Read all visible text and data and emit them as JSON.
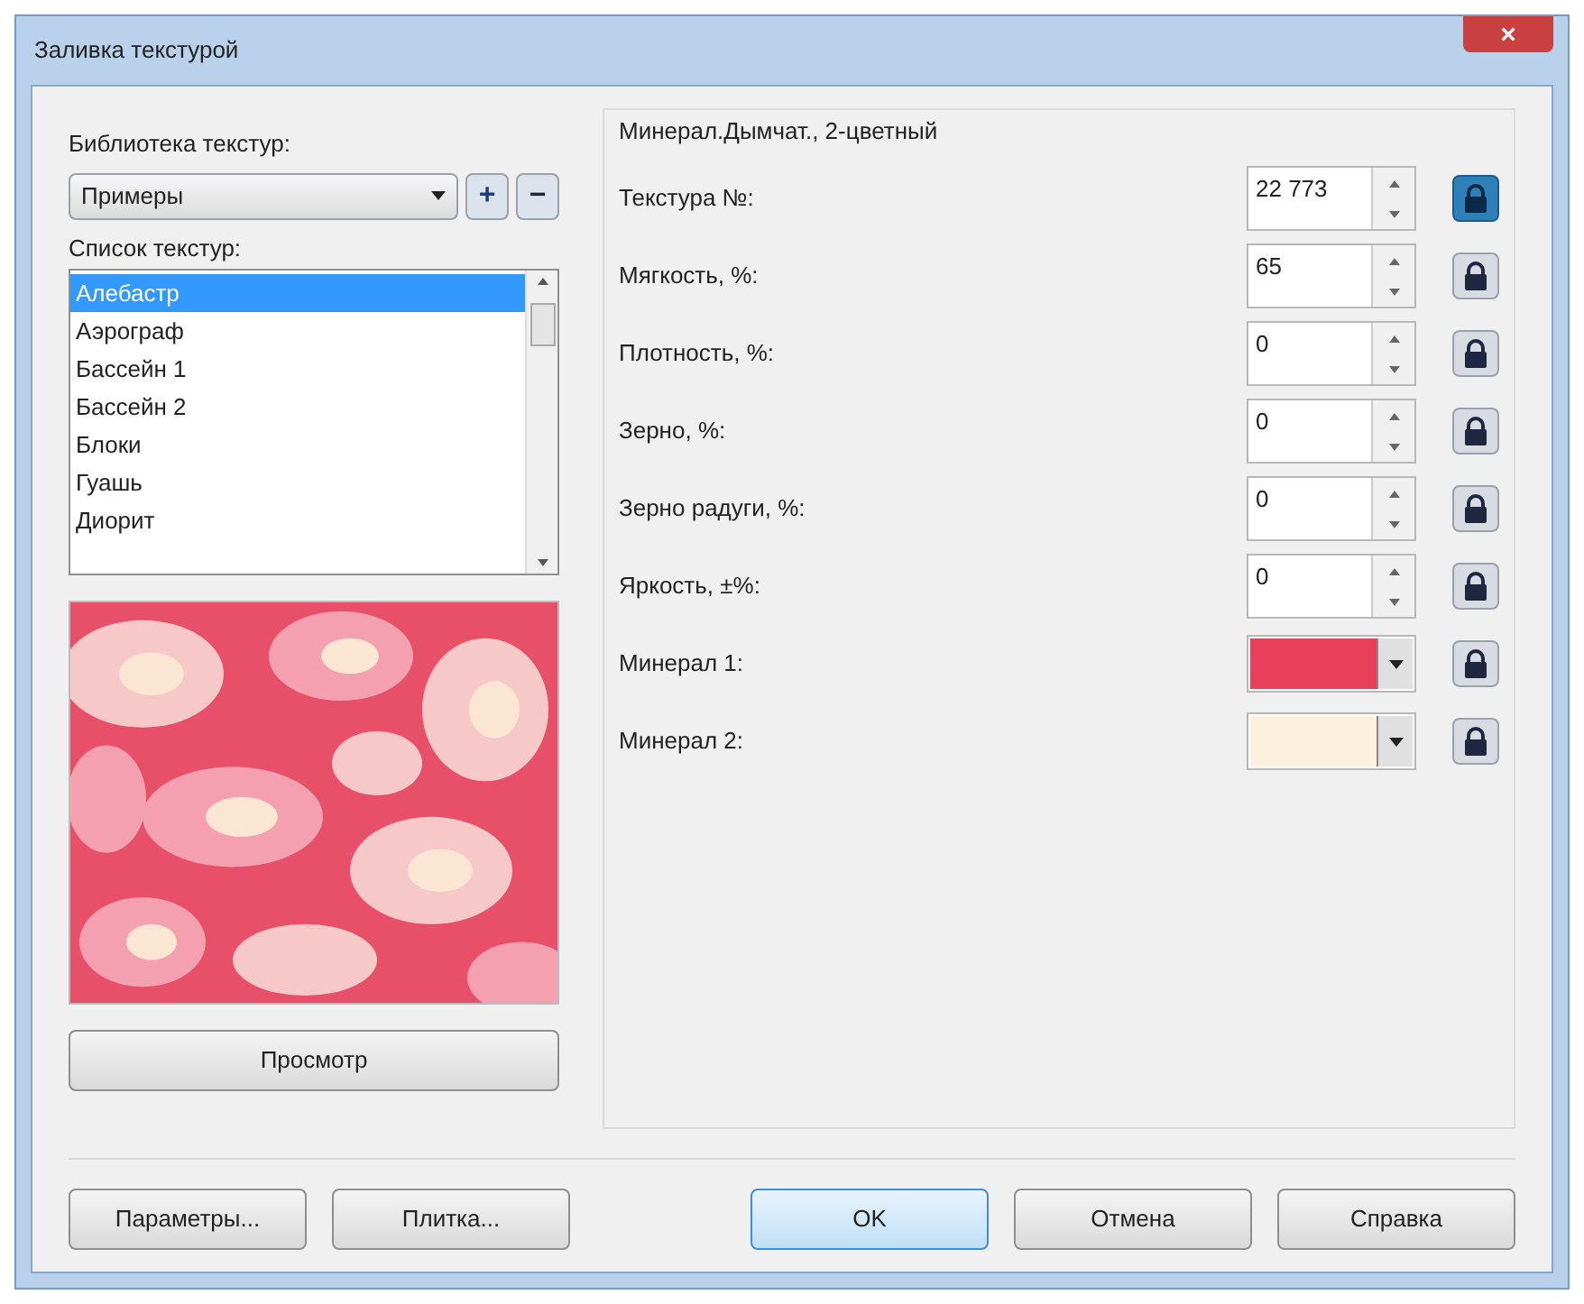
{
  "window": {
    "title": "Заливка текстурой",
    "close": "×"
  },
  "library": {
    "label": "Библиотека текстур:",
    "value": "Примеры",
    "add": "+",
    "remove": "−"
  },
  "texture_list": {
    "label": "Список текстур:",
    "items": [
      {
        "name": "Алебастр",
        "selected": true
      },
      {
        "name": "Аэрограф",
        "selected": false
      },
      {
        "name": "Бассейн 1",
        "selected": false
      },
      {
        "name": "Бассейн 2",
        "selected": false
      },
      {
        "name": "Блоки",
        "selected": false
      },
      {
        "name": "Гуашь",
        "selected": false
      },
      {
        "name": "Диорит",
        "selected": false
      }
    ]
  },
  "preview_button": "Просмотр",
  "params": {
    "title": "Минерал.Дымчат., 2-цветный",
    "rows": [
      {
        "kind": "spin",
        "label": "Текстура №:",
        "value": "22 773",
        "lock_active": true
      },
      {
        "kind": "spin",
        "label": "Мягкость, %:",
        "value": "65",
        "lock_active": false
      },
      {
        "kind": "spin",
        "label": "Плотность, %:",
        "value": "0",
        "lock_active": false
      },
      {
        "kind": "spin",
        "label": "Зерно, %:",
        "value": "0",
        "lock_active": false
      },
      {
        "kind": "spin",
        "label": "Зерно радуги, %:",
        "value": "0",
        "lock_active": false
      },
      {
        "kind": "spin",
        "label": "Яркость, ±%:",
        "value": "0",
        "lock_active": false
      },
      {
        "kind": "color",
        "label": "Минерал 1:",
        "color": "#e8405a",
        "lock_active": false
      },
      {
        "kind": "color",
        "label": "Минерал 2:",
        "color": "#fdf0dc",
        "lock_active": false
      }
    ]
  },
  "buttons": [
    {
      "label": "Параметры...",
      "kind": "left",
      "default": false
    },
    {
      "label": "Плитка...",
      "kind": "left",
      "default": false
    },
    {
      "label": "OK",
      "kind": "right",
      "default": true
    },
    {
      "label": "Отмена",
      "kind": "right",
      "default": false
    },
    {
      "label": "Справка",
      "kind": "right",
      "default": false
    }
  ]
}
